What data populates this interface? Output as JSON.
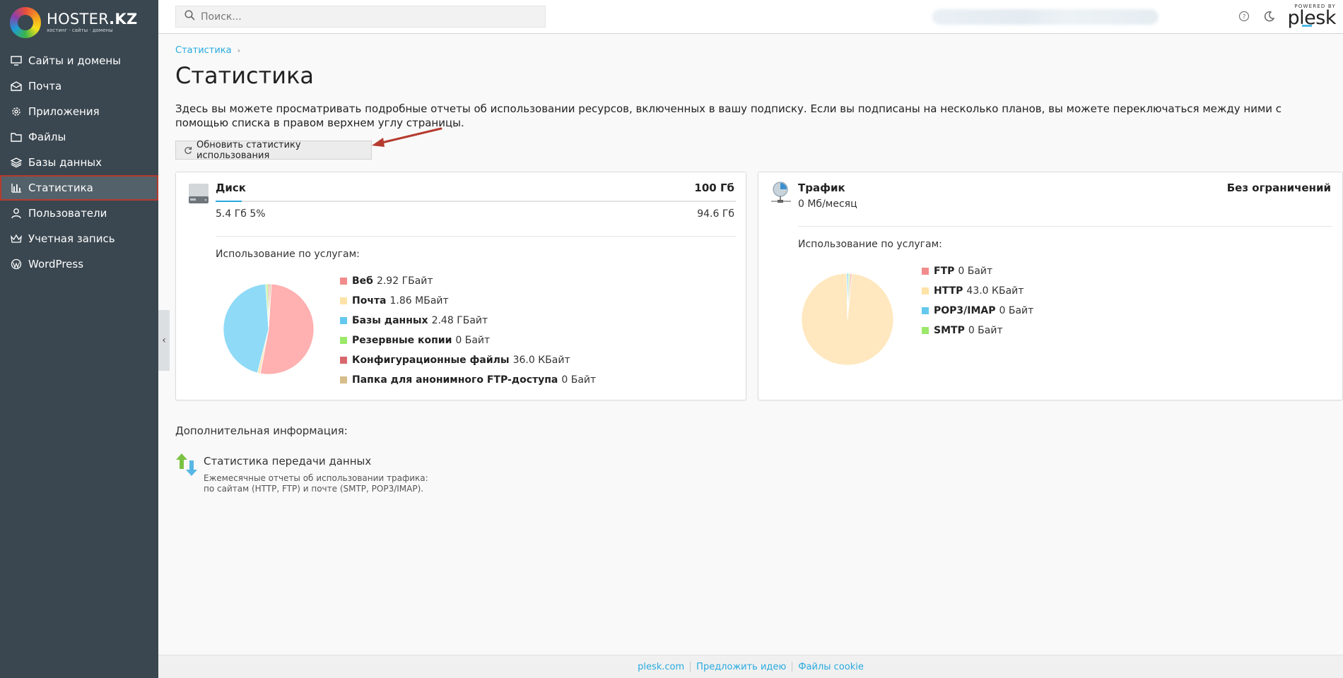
{
  "brand": {
    "name": "HOSTER",
    "name_suffix": ".KZ",
    "tagline": "хостинг · сайты · домены"
  },
  "sidebar": {
    "items": [
      {
        "label": "Сайты и домены",
        "icon": "monitor-icon"
      },
      {
        "label": "Почта",
        "icon": "mail-icon"
      },
      {
        "label": "Приложения",
        "icon": "gear-icon"
      },
      {
        "label": "Файлы",
        "icon": "folder-icon"
      },
      {
        "label": "Базы данных",
        "icon": "layers-icon"
      },
      {
        "label": "Статистика",
        "icon": "bar-chart-icon",
        "active": true
      },
      {
        "label": "Пользователи",
        "icon": "user-icon"
      },
      {
        "label": "Учетная запись",
        "icon": "crown-icon"
      },
      {
        "label": "WordPress",
        "icon": "wordpress-icon"
      }
    ]
  },
  "header": {
    "search_placeholder": "Поиск...",
    "plesk_powered": "POWERED BY",
    "plesk_name": "plesk"
  },
  "breadcrumb": {
    "item": "Статистика"
  },
  "page": {
    "title": "Статистика",
    "intro": "Здесь вы можете просматривать подробные отчеты об использовании ресурсов, включенных в вашу подписку. Если вы подписаны на несколько планов, вы можете переключаться между ними с помощью списка в правом верхнем углу страницы.",
    "refresh_button": "Обновить статистику использования"
  },
  "disk": {
    "title": "Диск",
    "limit": "100 Гб",
    "used": "5.4 Гб 5%",
    "free": "94.6 Гб",
    "used_fraction": 0.05,
    "usage_label": "Использование по услугам:",
    "legend": [
      {
        "name": "Веб",
        "value": "2.92 ГБайт",
        "color": "#f28b8b"
      },
      {
        "name": "Почта",
        "value": "1.86 МБайт",
        "color": "#fde3a7"
      },
      {
        "name": "Базы данных",
        "value": "2.48 ГБайт",
        "color": "#64c8ee"
      },
      {
        "name": "Резервные копии",
        "value": "0 Байт",
        "color": "#9be86a"
      },
      {
        "name": "Конфигурационные файлы",
        "value": "36.0 КБайт",
        "color": "#d9686c"
      },
      {
        "name": "Папка для анонимного FTP-доступа",
        "value": "0 Байт",
        "color": "#d6bd8b"
      }
    ]
  },
  "traffic": {
    "title": "Трафик",
    "limit": "Без ограничений",
    "used": "0 Мб/месяц",
    "usage_label": "Использование по услугам:",
    "legend": [
      {
        "name": "FTP",
        "value": "0 Байт",
        "color": "#f28b8b"
      },
      {
        "name": "HTTP",
        "value": "43.0 КБайт",
        "color": "#fde3a7"
      },
      {
        "name": "POP3/IMAP",
        "value": "0 Байт",
        "color": "#64c8ee"
      },
      {
        "name": "SMTP",
        "value": "0 Байт",
        "color": "#9be86a"
      }
    ]
  },
  "chart_data": [
    {
      "type": "pie",
      "categories": [
        "Веб",
        "Почта",
        "Базы данных",
        "Резервные копии",
        "Конфигурационные файлы",
        "Папка для анонимного FTP-доступа"
      ],
      "values": [
        52,
        1,
        45,
        1,
        0.5,
        0.5
      ],
      "colors": [
        "#ffb0b0",
        "#fde3b8",
        "#8fdaf7",
        "#c9f0a4",
        "#e48b8e",
        "#d9c39a"
      ]
    },
    {
      "type": "pie",
      "categories": [
        "FTP",
        "HTTP",
        "POP3/IMAP",
        "SMTP"
      ],
      "values": [
        0.6,
        98.2,
        0.6,
        0.6
      ],
      "colors": [
        "#ffb0b0",
        "#ffe8bf",
        "#8fdaf7",
        "#c9f0a4"
      ]
    }
  ],
  "extra": {
    "title": "Дополнительная информация:",
    "link": "Статистика передачи данных",
    "desc": "Ежемесячные отчеты об использовании трафика: по сайтам (HTTP, FTP) и почте (SMTP, POP3/IMAP)."
  },
  "footer": {
    "links": [
      "plesk.com",
      "Предложить идею",
      "Файлы cookie"
    ]
  }
}
